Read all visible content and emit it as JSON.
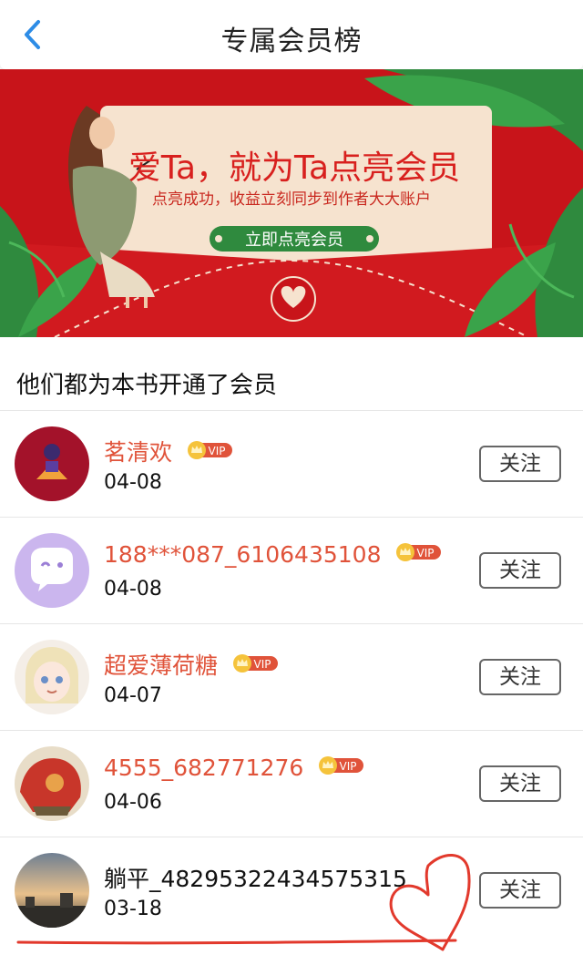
{
  "header": {
    "title": "专属会员榜",
    "back_icon": "chevron-left-icon"
  },
  "banner": {
    "headline": "爱Ta，就为Ta点亮会员",
    "subline": "点亮成功，收益立刻同步到作者大大账户",
    "cta": "立即点亮会员",
    "colors": {
      "background": "#c8141a",
      "card": "#f6e3cf",
      "button": "#2f8a3e",
      "text": "#d8201e"
    }
  },
  "section": {
    "title": "他们都为本书开通了会员"
  },
  "members": [
    {
      "name": "茗清欢",
      "date": "04-08",
      "vip": true,
      "follow_label": "关注"
    },
    {
      "name": "188***087_6106435108",
      "date": "04-08",
      "vip": true,
      "follow_label": "关注"
    },
    {
      "name": "超爱薄荷糖",
      "date": "04-07",
      "vip": true,
      "follow_label": "关注"
    },
    {
      "name": "4555_682771276",
      "date": "04-06",
      "vip": true,
      "follow_label": "关注"
    },
    {
      "name": "躺平_48295322434575315",
      "date": "03-18",
      "vip": false,
      "follow_label": "关注"
    }
  ],
  "vip_badge": {
    "label": "VIP",
    "icon": "crown-icon",
    "color": "#e0533a"
  }
}
